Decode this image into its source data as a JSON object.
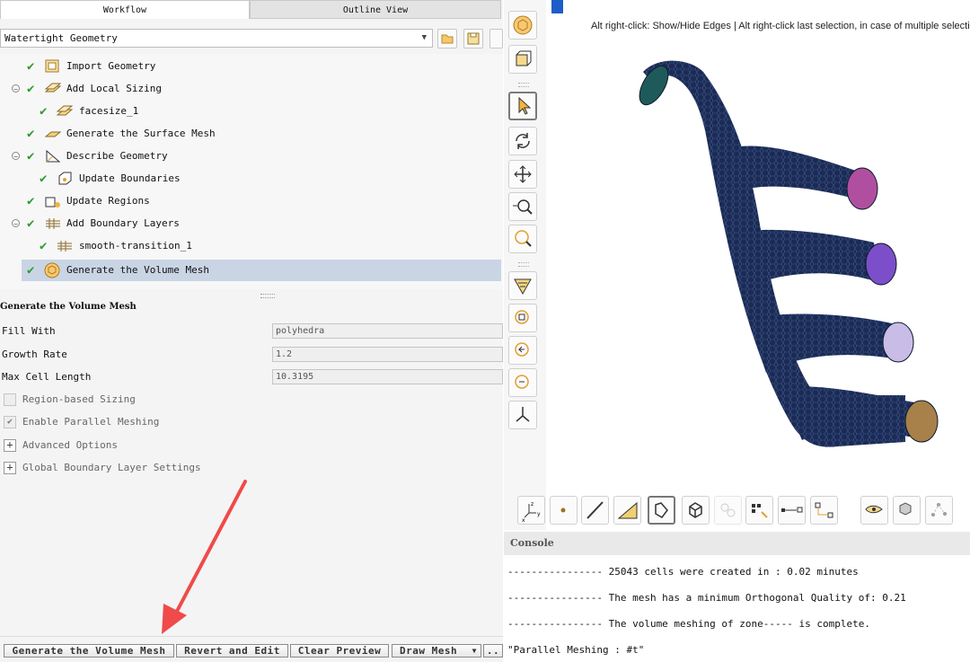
{
  "tabs": {
    "workflow": "Workflow",
    "outline": "Outline View"
  },
  "workflow_select": {
    "value": "Watertight Geometry"
  },
  "tree": [
    {
      "label": "Import Geometry"
    },
    {
      "label": "Add Local Sizing"
    },
    {
      "label": "facesize_1"
    },
    {
      "label": "Generate the Surface Mesh"
    },
    {
      "label": "Describe Geometry"
    },
    {
      "label": "Update Boundaries"
    },
    {
      "label": "Update Regions"
    },
    {
      "label": "Add Boundary Layers"
    },
    {
      "label": "smooth-transition_1"
    },
    {
      "label": "Generate the Volume Mesh"
    }
  ],
  "properties": {
    "title": "Generate the Volume Mesh",
    "fill_with": {
      "label": "Fill With",
      "value": "polyhedra"
    },
    "growth_rate": {
      "label": "Growth Rate",
      "value": "1.2"
    },
    "max_cell_length": {
      "label": "Max Cell Length",
      "value": "10.3195"
    },
    "region_sizing": {
      "label": "Region-based Sizing",
      "checked": false
    },
    "parallel_meshing": {
      "label": "Enable Parallel Meshing",
      "checked": true
    },
    "advanced": {
      "label": "Advanced Options"
    },
    "global_bl": {
      "label": "Global Boundary Layer Settings"
    }
  },
  "actions": {
    "generate": "Generate the Volume Mesh",
    "revert": "Revert and Edit",
    "clear": "Clear Preview",
    "draw": "Draw Mesh",
    "more": ".."
  },
  "graphics": {
    "hint": "Alt right-click: Show/Hide Edges | Alt right-click last selection, in case of multiple selections",
    "mesh_color": "#1b2b55",
    "outlet_colors": [
      "#1f5a5a",
      "#b04f9f",
      "#7d4ec9",
      "#c9bde8",
      "#a8804a"
    ]
  },
  "console": {
    "title": "Console",
    "lines": [
      "---------------- 25043 cells were created in :  0.02 minutes",
      "---------------- The mesh has a minimum Orthogonal Quality of:  0.21",
      "---------------- The volume meshing of zone----- is complete.",
      "\"Parallel Meshing : #t\""
    ]
  },
  "colors": {
    "selection": "#c9d5e4",
    "check": "#2f9a2f",
    "annotation_arrow": "#f04a4a"
  }
}
